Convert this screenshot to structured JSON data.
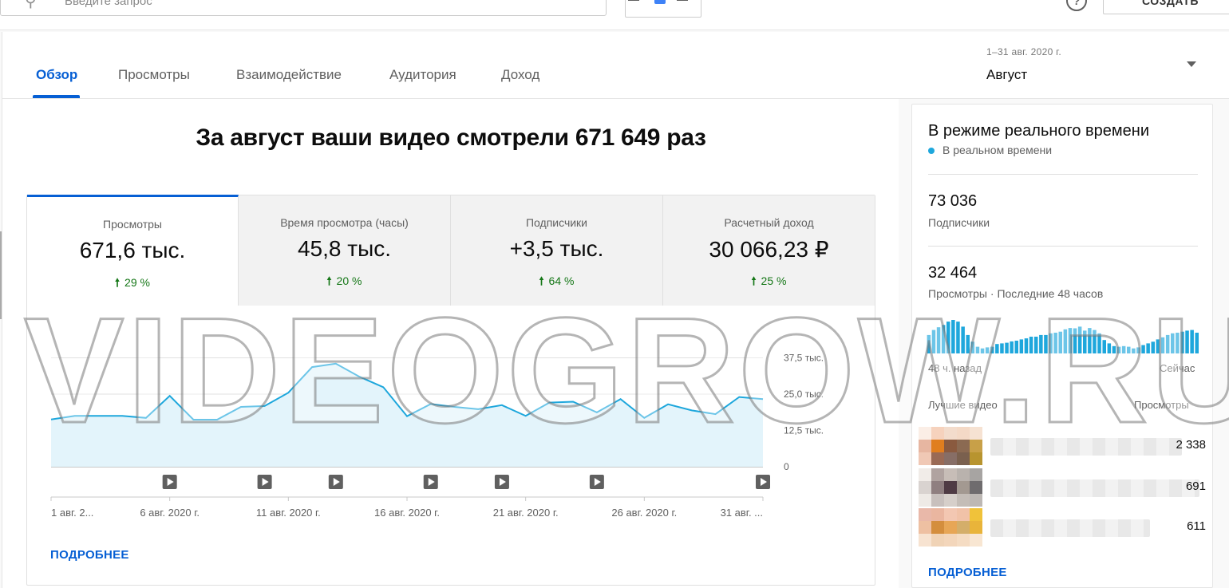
{
  "header": {
    "search_placeholder": "Введите запрос",
    "help_label": "?",
    "create_label": "СОЗДАТЬ"
  },
  "tabs": [
    {
      "label": "Обзор",
      "active": true
    },
    {
      "label": "Просмотры",
      "active": false
    },
    {
      "label": "Взаимодействие",
      "active": false
    },
    {
      "label": "Аудитория",
      "active": false
    },
    {
      "label": "Доход",
      "active": false
    }
  ],
  "date": {
    "range": "1–31 авг. 2020 г.",
    "value": "Август"
  },
  "main": {
    "headline": "За август ваши видео смотрели 671 649 раз",
    "metrics": [
      {
        "label": "Просмотры",
        "value": "671,6 тыс.",
        "change": "29 %",
        "active": true
      },
      {
        "label": "Время просмотра (часы)",
        "value": "45,8 тыс.",
        "change": "20 %",
        "active": false
      },
      {
        "label": "Подписчики",
        "value": "+3,5 тыс.",
        "change": "64 %",
        "active": false
      },
      {
        "label": "Расчетный доход",
        "value": "30 066,23 ₽",
        "change": "25 %",
        "active": false
      }
    ],
    "more_label": "ПОДРОБНЕЕ"
  },
  "chart_data": {
    "type": "area",
    "x": [
      "1 авг.",
      "2 авг.",
      "3 авг.",
      "4 авг.",
      "5 авг.",
      "6 авг.",
      "7 авг.",
      "8 авг.",
      "9 авг.",
      "10 авг.",
      "11 авг.",
      "12 авг.",
      "13 авг.",
      "14 авг.",
      "15 авг.",
      "16 авг.",
      "17 авг.",
      "18 авг.",
      "19 авг.",
      "20 авг.",
      "21 авг.",
      "22 авг.",
      "23 авг.",
      "24 авг.",
      "25 авг.",
      "26 авг.",
      "27 авг.",
      "28 авг.",
      "29 авг.",
      "30 авг.",
      "31 авг."
    ],
    "values": [
      16.3,
      17.5,
      17.5,
      17.5,
      16.8,
      24.4,
      16.2,
      16.2,
      20.6,
      20.9,
      25.5,
      34.3,
      35.5,
      31.0,
      27.4,
      17.4,
      21.6,
      20.6,
      19.8,
      21.2,
      17.5,
      22.1,
      22.4,
      18.7,
      23.3,
      16.8,
      21.5,
      19.4,
      18.1,
      24.0,
      23.3
    ],
    "y_ticks": [
      "37,5 тыс.",
      "25,0 тыс.",
      "12,5 тыс.",
      "0"
    ],
    "ylim": [
      0,
      50
    ],
    "x_tick_labels": [
      "1 авг. 2...",
      "6 авг. 2020 г.",
      "11 авг. 2020 г.",
      "16 авг. 2020 г.",
      "21 авг. 2020 г.",
      "26 авг. 2020 г.",
      "31 авг. ..."
    ],
    "video_markers": [
      6,
      10,
      13,
      17,
      20,
      24,
      31
    ],
    "color": "#1ea7dc",
    "fill": "#e3f4fb"
  },
  "realtime": {
    "title": "В режиме реального времени",
    "live_label": "В реальном времени",
    "subscribers_value": "73 036",
    "subscribers_label": "Подписчики",
    "views_value": "32 464",
    "views_label": "Просмотры · Последние 48 часов",
    "bars": [
      0.55,
      0.7,
      0.78,
      0.85,
      0.95,
      1.0,
      0.95,
      0.8,
      0.55,
      0.35,
      0.2,
      0.15,
      0.18,
      0.2,
      0.28,
      0.3,
      0.32,
      0.36,
      0.38,
      0.42,
      0.45,
      0.5,
      0.5,
      0.55,
      0.55,
      0.6,
      0.62,
      0.65,
      0.72,
      0.76,
      0.75,
      0.8,
      0.68,
      0.76,
      0.7,
      0.6,
      0.4,
      0.3,
      0.22,
      0.2,
      0.22,
      0.2,
      0.15,
      0.18,
      0.25,
      0.3,
      0.35,
      0.42,
      0.48,
      0.55,
      0.6,
      0.62,
      0.65,
      0.68,
      0.7,
      0.62
    ],
    "axis_left": "48 ч. назад",
    "axis_right": "Сейчас",
    "top_videos_label": "Лучшие видео",
    "views_col_label": "Просмотры",
    "videos": [
      {
        "views": "2 338"
      },
      {
        "views": "691"
      },
      {
        "views": "611"
      }
    ],
    "more_label": "ПОДРОБНЕЕ"
  },
  "watermark": "VIDEOGROW.RU"
}
